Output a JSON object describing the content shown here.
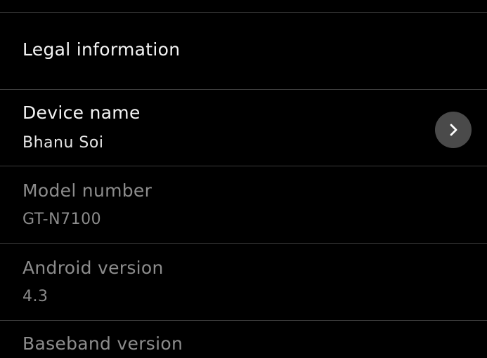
{
  "items": [
    {
      "title": "Legal information"
    },
    {
      "title": "Device name",
      "value": "Bhanu Soi"
    },
    {
      "title": "Model number",
      "value": "GT-N7100"
    },
    {
      "title": "Android version",
      "value": "4.3"
    },
    {
      "title": "Baseband version"
    }
  ],
  "icons": {
    "device_name_action": "chevron-right-icon"
  }
}
